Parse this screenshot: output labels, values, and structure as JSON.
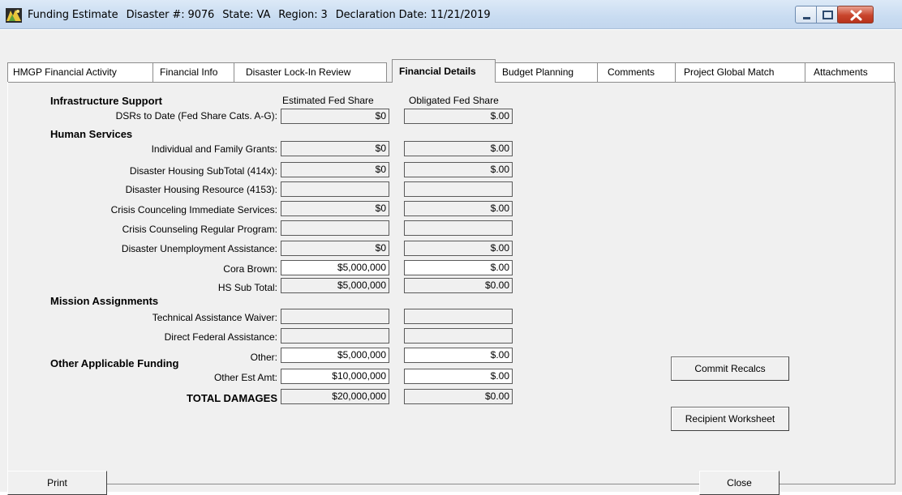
{
  "window": {
    "title_parts": [
      "Funding Estimate",
      "Disaster #: 9076",
      "State: VA",
      "Region: 3",
      "Declaration Date: 11/21/2019"
    ]
  },
  "tabs": [
    {
      "label": "HMGP Financial Activity"
    },
    {
      "label": "Financial Info"
    },
    {
      "label": "Disaster Lock-In Review"
    },
    {
      "label": "Financial Details",
      "active": true
    },
    {
      "label": "Budget Planning"
    },
    {
      "label": "Comments"
    },
    {
      "label": "Project Global Match"
    },
    {
      "label": "Attachments"
    }
  ],
  "columns": {
    "estimated": "Estimated Fed Share",
    "obligated": "Obligated Fed Share"
  },
  "sections": {
    "infrastructure": "Infrastructure Support",
    "human_services": "Human Services",
    "mission": "Mission Assignments",
    "other_funding": "Other Applicable Funding"
  },
  "rows": [
    {
      "label": "DSRs to Date (Fed Share Cats. A-G):",
      "est": "$0",
      "obl": "$.00"
    },
    {
      "label": "Individual and Family Grants:",
      "est": "$0",
      "obl": "$.00"
    },
    {
      "label": "Disaster Housing SubTotal (414x):",
      "est": "$0",
      "obl": "$.00"
    },
    {
      "label": "Disaster Housing Resource (4153):",
      "est": "",
      "obl": ""
    },
    {
      "label": "Crisis Counceling Immediate Services:",
      "est": "$0",
      "obl": "$.00"
    },
    {
      "label": "Crisis Counseling Regular Program:",
      "est": "",
      "obl": ""
    },
    {
      "label": "Disaster Unemployment Assistance:",
      "est": "$0",
      "obl": "$.00"
    },
    {
      "label": "Cora Brown:",
      "est": "$5,000,000",
      "obl": "$.00"
    },
    {
      "label": "HS Sub Total:",
      "est": "$5,000,000",
      "obl": "$0.00"
    },
    {
      "label": "Technical Assistance Waiver:",
      "est": "",
      "obl": ""
    },
    {
      "label": "Direct Federal Assistance:",
      "est": "",
      "obl": ""
    },
    {
      "label": "Other:",
      "est": "$5,000,000",
      "obl": "$.00"
    },
    {
      "label": "Other Est Amt:",
      "est": "$10,000,000",
      "obl": "$.00"
    },
    {
      "label": "TOTAL DAMAGES",
      "est": "$20,000,000",
      "obl": "$0.00"
    }
  ],
  "buttons": {
    "commit": "Commit Recalcs",
    "recipient": "Recipient Worksheet",
    "print": "Print",
    "close": "Close"
  }
}
